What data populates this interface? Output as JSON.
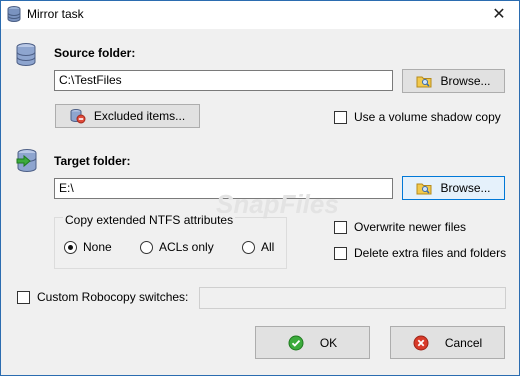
{
  "window": {
    "title": "Mirror task",
    "close_glyph": "✕"
  },
  "source": {
    "label": "Source folder:",
    "path": "C:\\TestFiles",
    "browse_label": "Browse...",
    "excluded_label": "Excluded items...",
    "shadow_copy_label": "Use a volume shadow copy",
    "shadow_copy_checked": false
  },
  "target": {
    "label": "Target folder:",
    "path": "E:\\",
    "browse_label": "Browse...",
    "ntfs_group_label": "Copy extended NTFS attributes",
    "ntfs_options": [
      {
        "label": "None",
        "selected": true
      },
      {
        "label": "ACLs only",
        "selected": false
      },
      {
        "label": "All",
        "selected": false
      }
    ],
    "overwrite_label": "Overwrite newer files",
    "overwrite_checked": false,
    "delete_extra_label": "Delete extra files and folders",
    "delete_extra_checked": false
  },
  "robocopy": {
    "label": "Custom Robocopy switches:",
    "checked": false,
    "value": ""
  },
  "buttons": {
    "ok_label": "OK",
    "cancel_label": "Cancel"
  },
  "watermark": {
    "text": "SnapFiles"
  },
  "icons": {
    "title": "database-icon",
    "source": "database-icon",
    "target": "database-arrow-icon",
    "browse": "folder-search-icon",
    "excluded": "exclude-icon",
    "ok": "check-icon",
    "cancel": "cancel-icon"
  },
  "colors": {
    "accent": "#0078d7",
    "ok_green": "#3cab3c",
    "cancel_red": "#d83b2a"
  }
}
